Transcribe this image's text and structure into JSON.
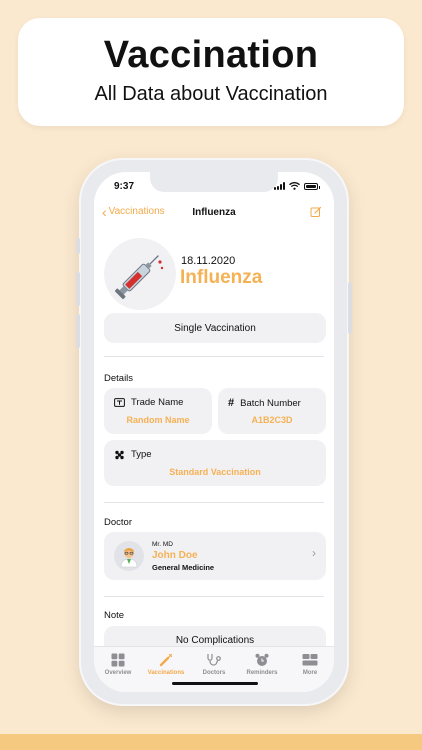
{
  "hero": {
    "title": "Vaccination",
    "subtitle": "All Data about Vaccination"
  },
  "status_bar": {
    "time": "9:37"
  },
  "nav": {
    "back_label": "Vaccinations",
    "title": "Influenza",
    "edit_icon": "edit-icon"
  },
  "vaccination": {
    "date": "18.11.2020",
    "name": "Influenza",
    "avatar_icon": "syringe-icon",
    "kind": "Single Vaccination"
  },
  "details": {
    "section_label": "Details",
    "trade_name": {
      "label": "Trade Name",
      "value": "Random Name",
      "icon": "tag-icon"
    },
    "batch_number": {
      "label": "Batch Number",
      "value": "A1B2C3D",
      "icon": "hash-icon"
    },
    "type": {
      "label": "Type",
      "value": "Standard Vaccination",
      "icon": "type-icon"
    }
  },
  "doctor": {
    "section_label": "Doctor",
    "title": "Mr. MD",
    "name": "John Doe",
    "specialty": "General Medicine",
    "avatar_icon": "doctor-icon"
  },
  "note": {
    "section_label": "Note",
    "text": "No Complications"
  },
  "tabs": [
    {
      "label": "Overview",
      "icon": "grid-icon",
      "active": false
    },
    {
      "label": "Vaccinations",
      "icon": "syringe-icon",
      "active": true
    },
    {
      "label": "Doctors",
      "icon": "stethoscope-icon",
      "active": false
    },
    {
      "label": "Reminders",
      "icon": "alarm-clock-icon",
      "active": false
    },
    {
      "label": "More",
      "icon": "more-icon",
      "active": false
    }
  ],
  "colors": {
    "accent": "#f5b153",
    "background": "#fbe9cf",
    "band": "#f5c97f"
  }
}
